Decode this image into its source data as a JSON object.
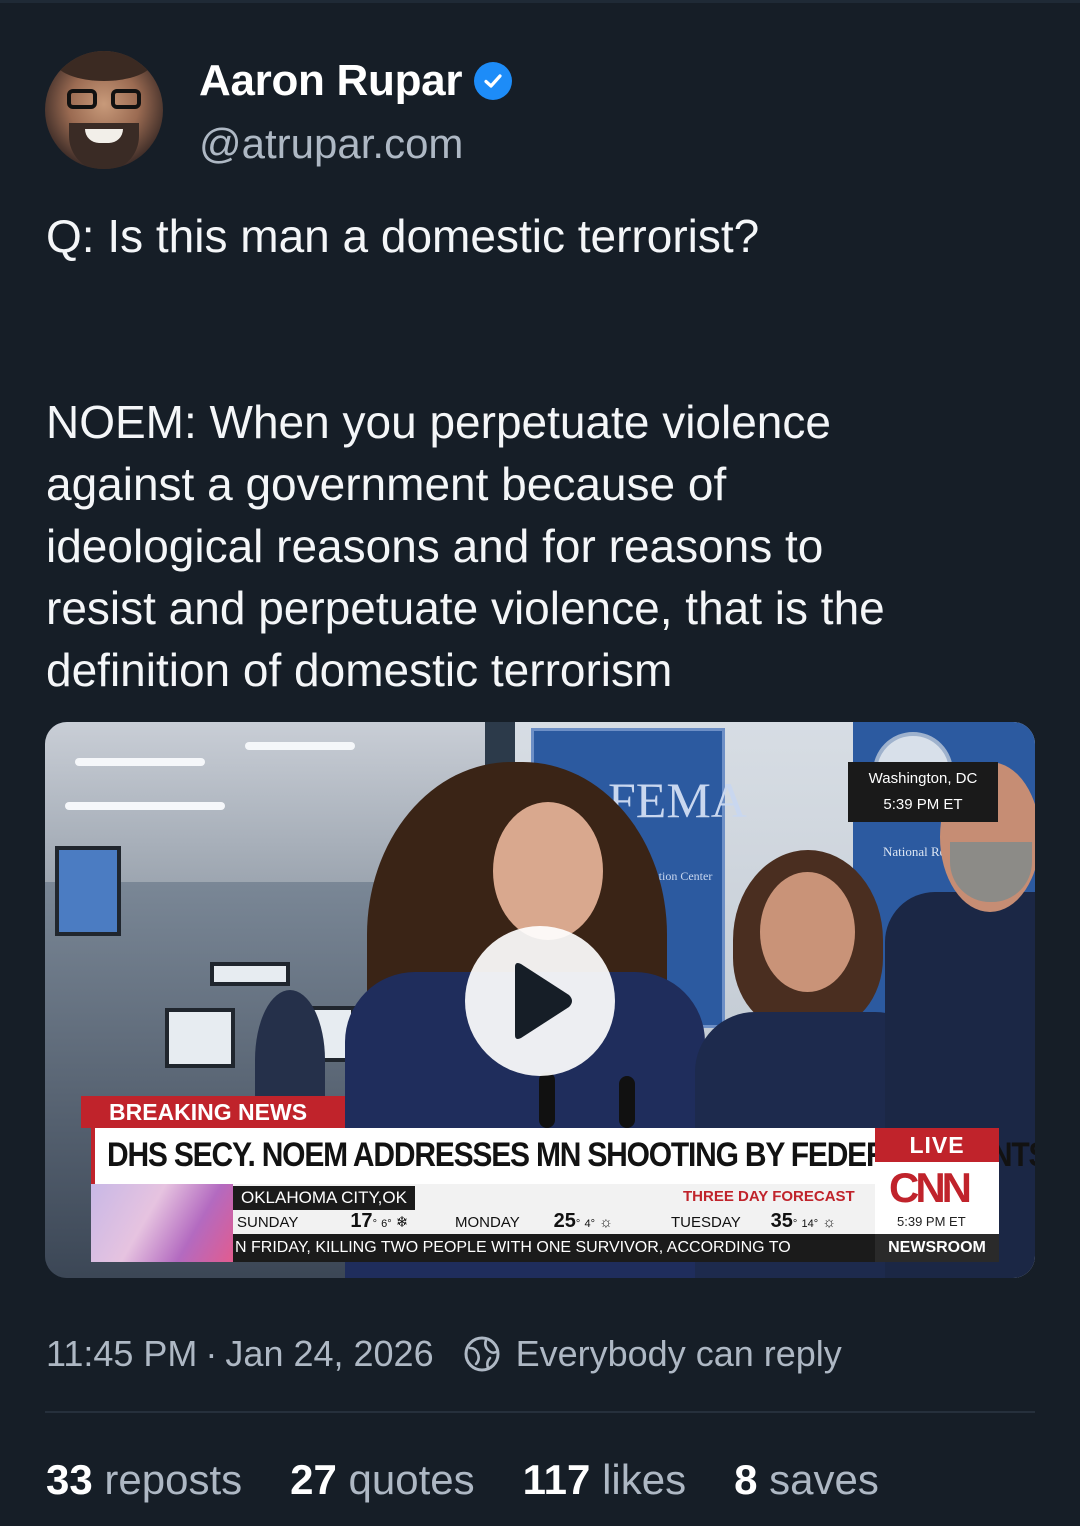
{
  "author": {
    "display_name": "Aaron Rupar",
    "handle": "@atrupar.com",
    "verified": true
  },
  "post": {
    "paragraphs": [
      "Q: Is this man a domestic terrorist?",
      "NOEM: When you perpetuate violence\nagainst a government because of\nideological reasons and for reasons to\nresist and perpetuate violence, that is the\ndefinition of domestic terrorism"
    ]
  },
  "video": {
    "location_line1": "Washington, DC",
    "location_line2": "5:39 PM ET",
    "sign_fema": "FEMA",
    "sign_fema_sub": "Coordination Center",
    "sign_seal_sub": "National Response",
    "breaking_label": "BREAKING NEWS",
    "headline": "DHS SECY. NOEM ADDRESSES MN SHOOTING BY FEDERAL AGENTS",
    "live_label": "LIVE",
    "network": "CNN",
    "network_time": "5:39 PM ET",
    "weather": {
      "city": "OKLAHOMA CITY,OK",
      "title": "THREE DAY FORECAST",
      "days": [
        {
          "day": "SUNDAY",
          "high": "17",
          "low": "6"
        },
        {
          "day": "MONDAY",
          "high": "25",
          "low": "4"
        },
        {
          "day": "TUESDAY",
          "high": "35",
          "low": "14"
        }
      ]
    },
    "ticker": "N FRIDAY, KILLING TWO PEOPLE WITH ONE SURVIVOR, ACCORDING TO",
    "ticker_brand": "NEWSROOM"
  },
  "meta": {
    "time": "11:45 PM",
    "separator": "·",
    "date": "Jan 24, 2026",
    "reply_setting": "Everybody can reply"
  },
  "stats": {
    "reposts_count": "33",
    "reposts_label": "reposts",
    "quotes_count": "27",
    "quotes_label": "quotes",
    "likes_count": "117",
    "likes_label": "likes",
    "saves_count": "8",
    "saves_label": "saves"
  },
  "colors": {
    "background": "#161e27",
    "verified_badge": "#1d8cf8",
    "cnn_red": "#c0232b"
  }
}
